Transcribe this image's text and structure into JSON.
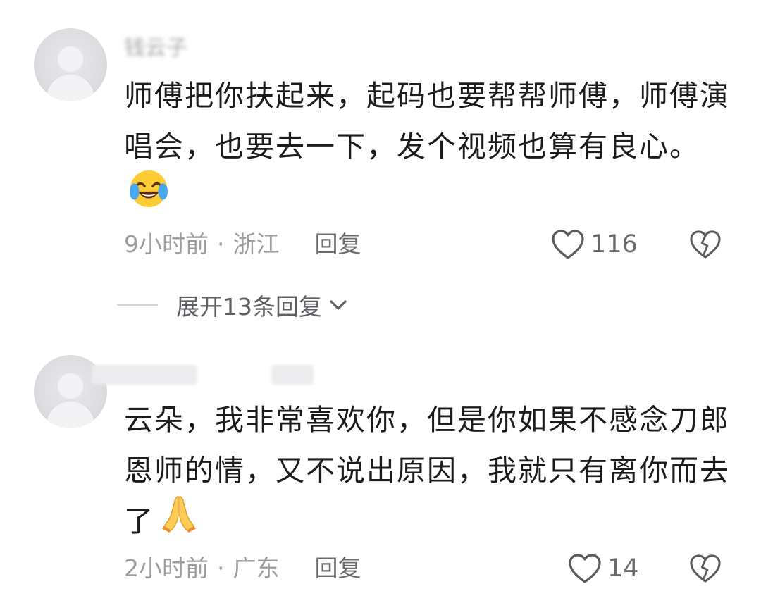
{
  "comments": [
    {
      "username": "钱云子",
      "text": "师傅把你扶起来，起码也要帮帮师傅，师傅演唱会，也要去一下，发个视频也算有良心。",
      "emoji_icon": "tears-of-joy-emoji",
      "time": "9小时前",
      "location": "浙江",
      "reply_label": "回复",
      "likes": "116",
      "expand_label": "展开13条回复"
    },
    {
      "username": "",
      "text": "云朵，我非常喜欢你，但是你如果不感念刀郎恩师的情，又不说出原因，我就只有离你而去了",
      "emoji_icon": "folded-hands-emoji",
      "time": "2小时前",
      "location": "广东",
      "reply_label": "回复",
      "likes": "14"
    }
  ],
  "separator": "·",
  "colors": {
    "text": "#1c1c1e",
    "meta": "#9c9ca1",
    "icon": "#5a5a5e"
  }
}
